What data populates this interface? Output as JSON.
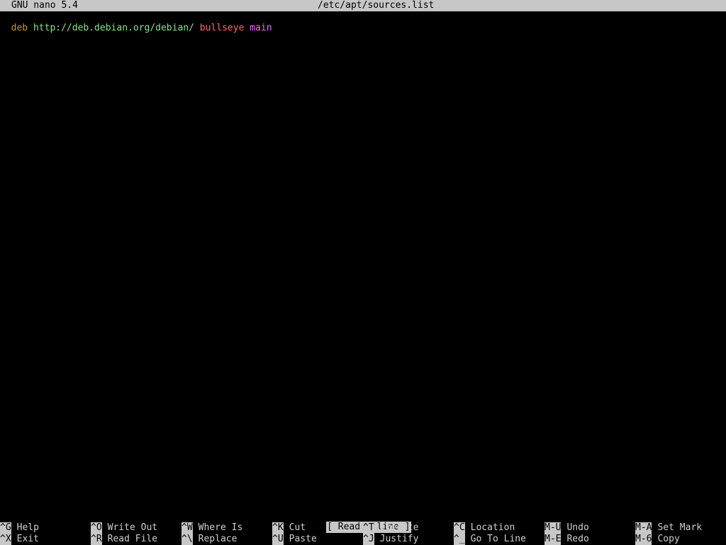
{
  "titlebar": {
    "app": "GNU nano 5.4",
    "filename": "/etc/apt/sources.list"
  },
  "editor": {
    "line1": [
      {
        "text": "deb",
        "color": "#c9903a"
      },
      {
        "text": " ",
        "color": "#cfcfcf"
      },
      {
        "text": "http://deb.debian.org/debian/",
        "color": "#8ce08c"
      },
      {
        "text": " ",
        "color": "#cfcfcf"
      },
      {
        "text": "bullseye",
        "color": "#ff6b6b"
      },
      {
        "text": " ",
        "color": "#cfcfcf"
      },
      {
        "text": "main",
        "color": "#e070ff"
      }
    ]
  },
  "status": {
    "message": "[ Read 1 line ]"
  },
  "shortcuts": {
    "row1": [
      {
        "key": "^G",
        "label": "Help"
      },
      {
        "key": "^O",
        "label": "Write Out"
      },
      {
        "key": "^W",
        "label": "Where Is"
      },
      {
        "key": "^K",
        "label": "Cut"
      },
      {
        "key": "^T",
        "label": "Execute"
      },
      {
        "key": "^C",
        "label": "Location"
      },
      {
        "key": "M-U",
        "label": "Undo"
      },
      {
        "key": "M-A",
        "label": "Set Mark"
      }
    ],
    "row2": [
      {
        "key": "^X",
        "label": "Exit"
      },
      {
        "key": "^R",
        "label": "Read File"
      },
      {
        "key": "^\\",
        "label": "Replace"
      },
      {
        "key": "^U",
        "label": "Paste"
      },
      {
        "key": "^J",
        "label": "Justify"
      },
      {
        "key": "^_",
        "label": "Go To Line"
      },
      {
        "key": "M-E",
        "label": "Redo"
      },
      {
        "key": "M-6",
        "label": "Copy"
      }
    ]
  }
}
